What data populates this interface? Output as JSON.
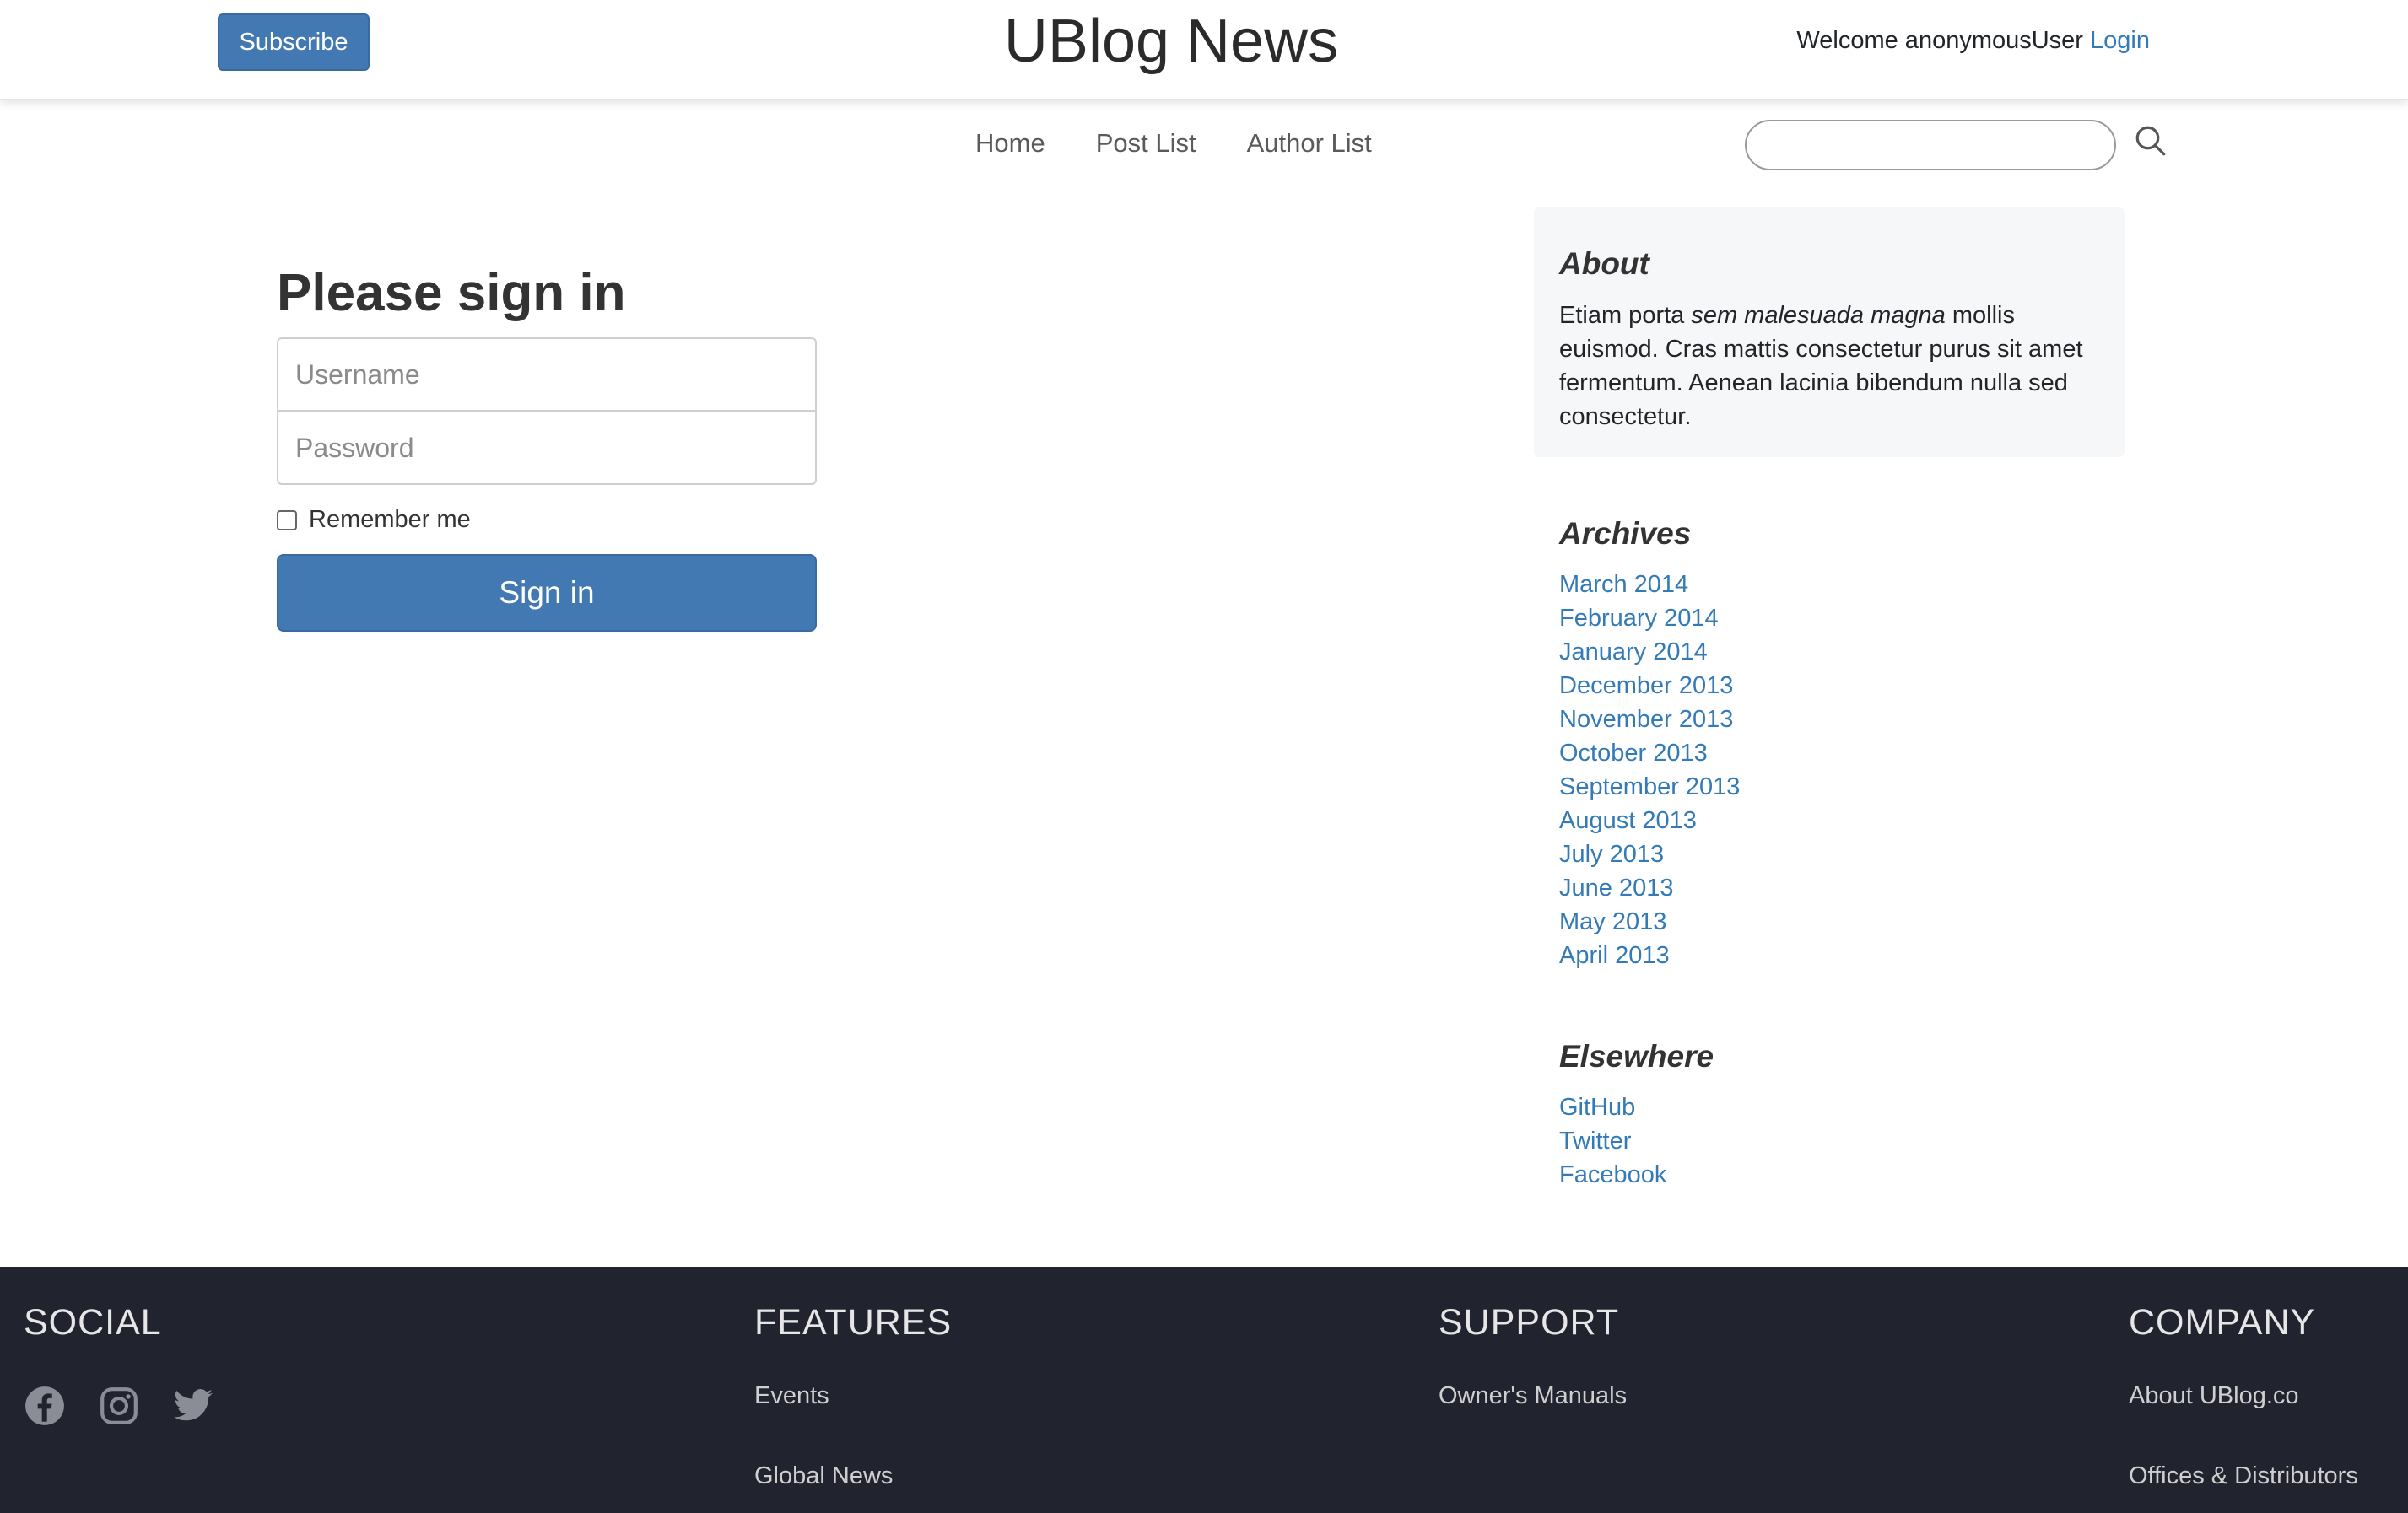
{
  "header": {
    "subscribe_label": "Subscribe",
    "title": "UBlog News",
    "welcome_text": "Welcome anonymousUser",
    "login_label": "Login"
  },
  "nav": {
    "items": [
      "Home",
      "Post List",
      "Author List"
    ],
    "search_value": "",
    "search_icon": "search-icon"
  },
  "signin": {
    "heading": "Please sign in",
    "username_placeholder": "Username",
    "password_placeholder": "Password",
    "remember_label": "Remember me",
    "remember_checked": false,
    "button_label": "Sign in"
  },
  "sidebar": {
    "about": {
      "heading": "About",
      "text_before": "Etiam porta ",
      "text_emphasis": "sem malesuada magna",
      "text_after": " mollis euismod. Cras mattis consectetur purus sit amet fermentum. Aenean lacinia bibendum nulla sed consectetur."
    },
    "archives": {
      "heading": "Archives",
      "items": [
        "March 2014",
        "February 2014",
        "January 2014",
        "December 2013",
        "November 2013",
        "October 2013",
        "September 2013",
        "August 2013",
        "July 2013",
        "June 2013",
        "May 2013",
        "April 2013"
      ]
    },
    "elsewhere": {
      "heading": "Elsewhere",
      "items": [
        "GitHub",
        "Twitter",
        "Facebook"
      ]
    }
  },
  "footer": {
    "social": {
      "heading": "SOCIAL",
      "icons": [
        "facebook-icon",
        "instagram-icon",
        "twitter-icon"
      ]
    },
    "features": {
      "heading": "FEATURES",
      "links": [
        "Events",
        "Global News"
      ]
    },
    "support": {
      "heading": "SUPPORT",
      "links": [
        "Owner's Manuals"
      ]
    },
    "company": {
      "heading": "COMPANY",
      "links": [
        "About UBlog.co",
        "Offices & Distributors"
      ]
    }
  },
  "colors": {
    "primary": "#4279b3",
    "link": "#337ab7",
    "footer_bg": "#21232e",
    "sidebar_bg": "#f6f7f9"
  }
}
